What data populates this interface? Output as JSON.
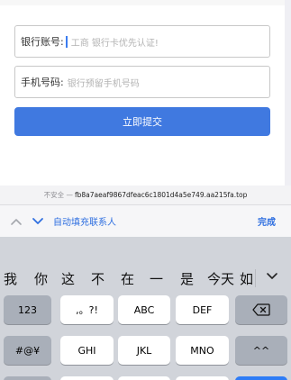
{
  "form": {
    "account_label": "银行账号:",
    "account_placeholder": "工商 银行卡优先认证!",
    "phone_label": "手机号码:",
    "phone_placeholder": "银行预留手机号码",
    "submit_label": "立即提交"
  },
  "urlbar": {
    "insecure": "不安全 —",
    "domain": "fb8a7aeaf9867dfeac6c1801d4a5e749.aa215fa.top"
  },
  "accessory": {
    "autofill_label": "自动填充联系人",
    "done_label": "完成"
  },
  "keyboard": {
    "candidates": [
      "我",
      "你",
      "这",
      "不",
      "在",
      "一",
      "是",
      "今天",
      "如"
    ],
    "row1": [
      "123",
      ",。?!",
      "ABC",
      "DEF"
    ],
    "row2": [
      "#@¥",
      "GHI",
      "JKL",
      "MNO",
      "^^"
    ]
  },
  "colors": {
    "accent": "#4079e0",
    "link": "#2f6fe0",
    "keyboard_bg": "#d1d4da"
  },
  "icons": {
    "up": "chevron-up-icon",
    "down": "chevron-down-icon",
    "delete": "backspace-icon",
    "more": "chevron-down-icon"
  }
}
